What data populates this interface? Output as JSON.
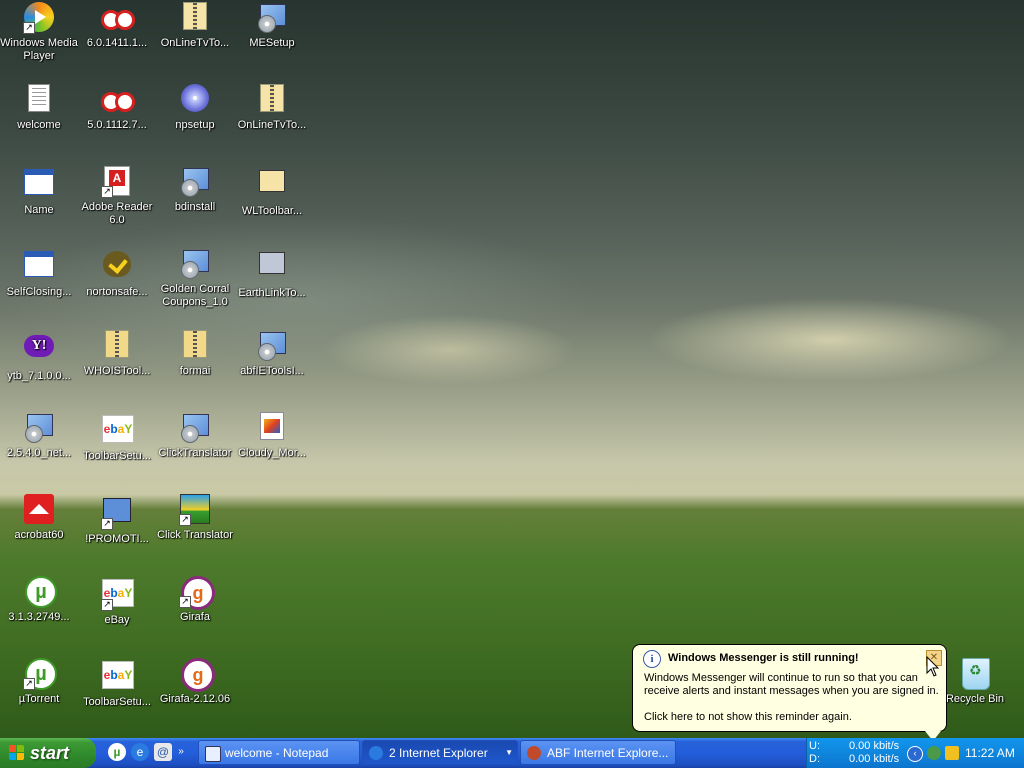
{
  "desktop": {
    "icons": [
      {
        "label": "Windows Media Player"
      },
      {
        "label": "6.0.1411.1..."
      },
      {
        "label": "OnLineTvTo..."
      },
      {
        "label": "MESetup"
      },
      {
        "label": "welcome"
      },
      {
        "label": "5.0.1112.7..."
      },
      {
        "label": "npsetup"
      },
      {
        "label": "OnLineTvTo..."
      },
      {
        "label": "Name"
      },
      {
        "label": "Adobe Reader 6.0"
      },
      {
        "label": "bdinstall"
      },
      {
        "label": "WLToolbar..."
      },
      {
        "label": "SelfClosing..."
      },
      {
        "label": "nortonsafe..."
      },
      {
        "label": "Golden Corral Coupons_1.0"
      },
      {
        "label": "EarthLinkTo..."
      },
      {
        "label": "ytb_7.1.0.0..."
      },
      {
        "label": "WHOISTool..."
      },
      {
        "label": "formai"
      },
      {
        "label": "abfIEToolsI..."
      },
      {
        "label": "2.5.4.0_net..."
      },
      {
        "label": "ToolbarSetu..."
      },
      {
        "label": "ClickTranslator"
      },
      {
        "label": "Cloudy_Mor..."
      },
      {
        "label": "acrobat60"
      },
      {
        "label": "!PROMOTI..."
      },
      {
        "label": "Click Translator"
      },
      {
        "label": "3.1.3.2749..."
      },
      {
        "label": "eBay"
      },
      {
        "label": "Girafa"
      },
      {
        "label": "µTorrent"
      },
      {
        "label": "ToolbarSetu..."
      },
      {
        "label": "Girafa-2.12.06"
      },
      {
        "label": "Recycle Bin"
      }
    ],
    "ebay_letters": {
      "e": "e",
      "b": "b",
      "a": "a",
      "y": "Y"
    },
    "utorrent_glyph": "µ",
    "yahoo_glyph": "Y!",
    "girafa_glyph": "g"
  },
  "taskbar": {
    "start_label": "start",
    "tasks": [
      {
        "label": "welcome - Notepad"
      },
      {
        "label": "2 Internet Explorer"
      },
      {
        "label": "ABF Internet Explore..."
      }
    ],
    "tray": {
      "upload_label": "U:",
      "download_label": "D:",
      "upload_rate": "0.00 kbit/s",
      "download_rate": "0.00 kbit/s",
      "clock": "11:22 AM"
    }
  },
  "balloon": {
    "title": "Windows Messenger is still running!",
    "body": "Windows Messenger will continue to run so that you can receive alerts and instant messages when you are signed in.",
    "link": "Click here to not show this reminder again.",
    "close_glyph": "✕",
    "info_glyph": "i"
  },
  "colors": {
    "taskbar_blue": "#245edb",
    "start_green": "#3c9a35",
    "tray_blue": "#0f8ae0",
    "balloon_bg": "#ffffe1"
  }
}
